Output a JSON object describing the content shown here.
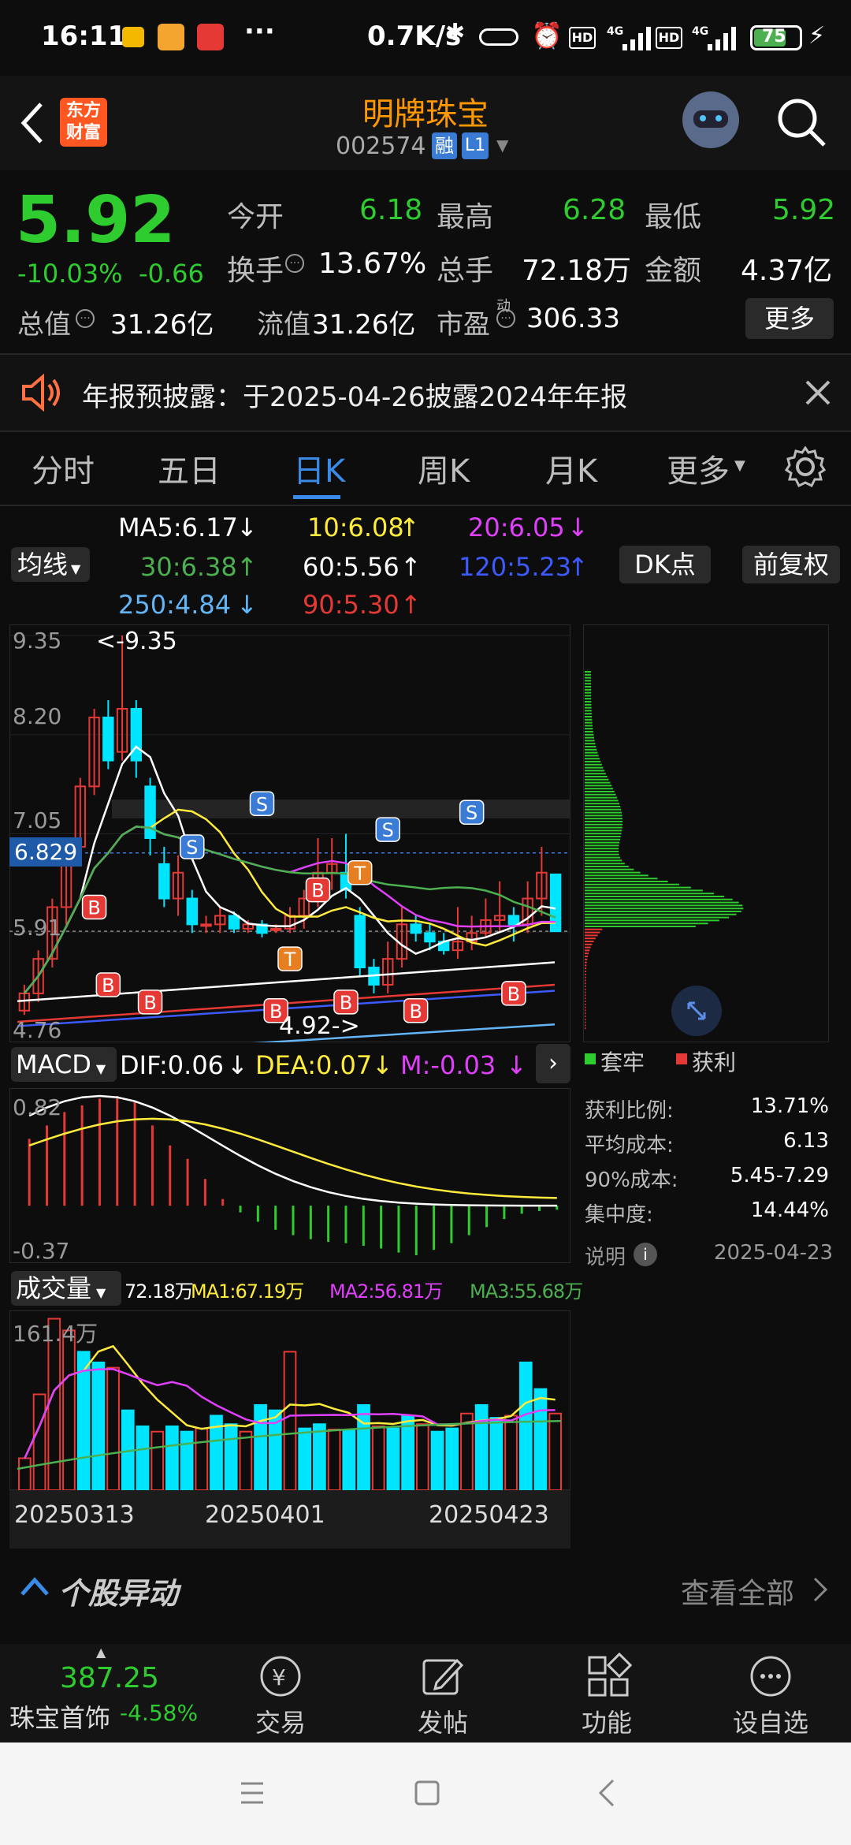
{
  "status_bar": {
    "time": "16:11",
    "dots": "···",
    "net_speed": "0.7K/s",
    "battery": "75"
  },
  "header": {
    "logo_line1": "东方",
    "logo_line2": "财富",
    "stock_name": "明牌珠宝",
    "stock_code": "002574",
    "badge_rong": "融",
    "badge_l1": "L1"
  },
  "quote": {
    "price": "5.92",
    "change_pct": "-10.03%",
    "change": "-0.66",
    "open_label": "今开",
    "open": "6.18",
    "high_label": "最高",
    "high": "6.28",
    "low_label": "最低",
    "low": "5.92",
    "turnover_label": "换手",
    "turnover": "13.67%",
    "volume_label": "总手",
    "volume": "72.18万",
    "amount_label": "金额",
    "amount": "4.37亿",
    "mcap_label": "总值",
    "mcap": "31.26亿",
    "float_label": "流值",
    "float": "31.26亿",
    "pe_label": "市盈",
    "pe_sup": "动",
    "pe": "306.33",
    "more": "更多"
  },
  "notice": {
    "text": "年报预披露：于2025-04-26披露2024年年报"
  },
  "tabs": [
    "分时",
    "五日",
    "日K",
    "周K",
    "月K",
    "更多"
  ],
  "active_tab": "日K",
  "ma_line": {
    "selector": "均线",
    "ma5": "MA5:6.17",
    "ma10": "10:6.08",
    "ma20": "20:6.05",
    "ma30": "30:6.38",
    "ma60": "60:5.56",
    "ma120": "120:5.23",
    "ma250": "250:4.84",
    "ma90": "90:5.30",
    "dk": "DK点",
    "adjust": "前复权"
  },
  "kchart": {
    "y_labels": [
      "9.35",
      "8.20",
      "7.05",
      "5.91",
      "4.76"
    ],
    "current_price_label": "6.829",
    "max_marker": "<-9.35",
    "min_marker": "4.92->"
  },
  "chart_data": {
    "type": "candlestick",
    "ylim": [
      4.76,
      9.35
    ],
    "candles": [
      [
        5.0,
        5.2,
        4.95,
        5.3
      ],
      [
        5.2,
        5.6,
        5.1,
        5.7
      ],
      [
        5.6,
        6.2,
        5.5,
        6.3
      ],
      [
        6.2,
        6.9,
        6.0,
        7.0
      ],
      [
        6.9,
        7.6,
        6.8,
        7.7
      ],
      [
        7.6,
        8.4,
        7.5,
        8.5
      ],
      [
        8.4,
        7.9,
        7.8,
        8.6
      ],
      [
        8.0,
        8.5,
        7.9,
        9.35
      ],
      [
        8.5,
        7.9,
        7.7,
        8.6
      ],
      [
        7.6,
        7.0,
        6.8,
        7.7
      ],
      [
        6.7,
        6.3,
        6.2,
        6.9
      ],
      [
        6.3,
        6.6,
        6.1,
        6.8
      ],
      [
        6.3,
        6.0,
        5.9,
        6.4
      ],
      [
        6.0,
        6.0,
        5.9,
        6.1
      ],
      [
        6.0,
        6.1,
        5.9,
        6.2
      ],
      [
        6.1,
        5.95,
        5.9,
        6.15
      ],
      [
        5.95,
        6.0,
        5.9,
        6.05
      ],
      [
        6.0,
        5.9,
        5.85,
        6.05
      ],
      [
        5.95,
        5.95,
        5.9,
        6.0
      ],
      [
        5.95,
        6.1,
        5.9,
        6.2
      ],
      [
        6.1,
        6.3,
        5.95,
        6.4
      ],
      [
        6.3,
        6.6,
        6.2,
        7.0
      ],
      [
        6.6,
        6.7,
        6.4,
        7.0
      ],
      [
        6.6,
        6.4,
        6.3,
        7.05
      ],
      [
        6.1,
        5.5,
        5.4,
        6.2
      ],
      [
        5.5,
        5.3,
        5.2,
        5.6
      ],
      [
        5.3,
        5.6,
        5.2,
        5.8
      ],
      [
        5.6,
        6.0,
        5.5,
        6.2
      ],
      [
        6.0,
        5.9,
        5.8,
        6.1
      ],
      [
        5.9,
        5.8,
        5.7,
        6.0
      ],
      [
        5.8,
        5.7,
        5.65,
        5.9
      ],
      [
        5.7,
        5.8,
        5.6,
        6.2
      ],
      [
        5.8,
        5.9,
        5.7,
        6.1
      ],
      [
        5.9,
        6.05,
        5.85,
        6.3
      ],
      [
        6.05,
        6.1,
        5.9,
        6.5
      ],
      [
        6.1,
        6.0,
        5.8,
        6.2
      ],
      [
        6.0,
        6.3,
        5.9,
        6.5
      ],
      [
        6.3,
        6.6,
        6.1,
        6.9
      ],
      [
        6.58,
        5.92,
        5.92,
        6.28
      ]
    ],
    "macd_ylabels": [
      "0.82",
      "-0.37"
    ],
    "macd_hist": [
      0.5,
      0.6,
      0.7,
      0.75,
      0.8,
      0.82,
      0.78,
      0.6,
      0.45,
      0.35,
      0.2,
      0.05,
      -0.05,
      -0.12,
      -0.18,
      -0.22,
      -0.25,
      -0.27,
      -0.28,
      -0.3,
      -0.32,
      -0.35,
      -0.37,
      -0.33,
      -0.28,
      -0.22,
      -0.16,
      -0.1,
      -0.06,
      -0.04,
      -0.03
    ],
    "vol_ylabel": "161.4万",
    "x_labels": [
      "20250313",
      "20250401",
      "20250423"
    ]
  },
  "indicators": {
    "macd_selector": "MACD",
    "dif": "DIF:0.06",
    "dea": "DEA:0.07",
    "m": "M:-0.03",
    "vol_selector": "成交量",
    "vol": "72.18万",
    "vol_ma1": "MA1:67.19万",
    "vol_ma2": "MA2:56.81万",
    "vol_ma3": "MA3:55.68万"
  },
  "chips": {
    "legend_trapped": "套牢",
    "legend_profit": "获利",
    "rows": [
      {
        "label": "获利比例:",
        "value": "13.71%"
      },
      {
        "label": "平均成本:",
        "value": "6.13"
      },
      {
        "label": "90%成本:",
        "value": "5.45-7.29"
      },
      {
        "label": "集中度:",
        "value": "14.44%"
      }
    ],
    "note": "说明",
    "date": "2025-04-23"
  },
  "movement": {
    "title": "个股异动",
    "view_all": "查看全部"
  },
  "bottom_nav": {
    "index_value": "387.25",
    "index_name": "珠宝首饰",
    "index_change": "-4.58%",
    "trade": "交易",
    "post": "发帖",
    "function": "功能",
    "watchlist": "设自选"
  },
  "colors": {
    "up": "#e53935",
    "down": "#2ecc2e",
    "accent": "#ff9800",
    "tab_active": "#3a8be8"
  }
}
